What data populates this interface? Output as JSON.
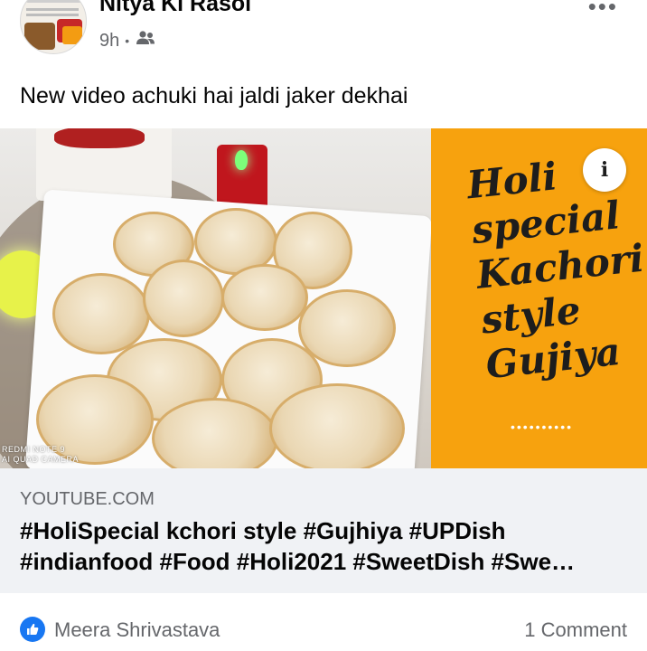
{
  "post": {
    "page_name": "Nitya Ki Rasoi",
    "time": "9h",
    "separator": "•",
    "audience_icon": "friends-icon",
    "more_icon": "more-horizontal-icon",
    "text": "New video achuki hai jaldi jaker dekhai"
  },
  "media": {
    "camera_watermark_line1": "REDMI NOTE 9",
    "camera_watermark_line2": "AI QUAD CAMERA",
    "promo_lines": [
      "Holi",
      "special",
      "Kachori",
      "style",
      "Gujiya"
    ],
    "promo_dots": "••••••••••",
    "info_label": "i",
    "promo_color": "#f7a20e"
  },
  "link": {
    "domain": "YOUTUBE.COM",
    "title_line1": "#HoliSpecial kchori style #Gujhiya #UPDish",
    "title_line2": "#indianfood #Food #Holi2021 #SweetDish #Swe…"
  },
  "footer": {
    "like_icon": "like-thumb-icon",
    "reactor_name": "Meera Shrivastava",
    "comments": "1 Comment",
    "accent": "#1877f2"
  }
}
